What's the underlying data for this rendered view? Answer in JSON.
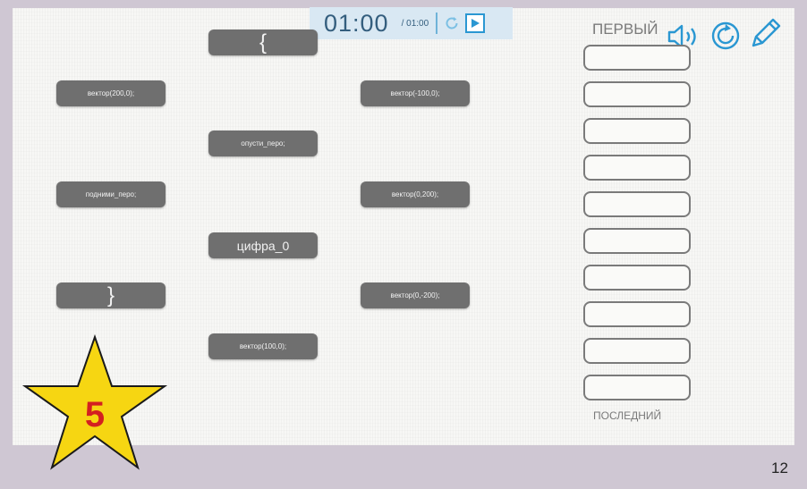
{
  "timer": {
    "time": "01:00",
    "total": "/ 01:00"
  },
  "cards": [
    {
      "id": "open-brace",
      "label": "{"
    },
    {
      "id": "vector-200-0",
      "label": "вектор(200,0);"
    },
    {
      "id": "vector-neg100-0",
      "label": "вектор(-100,0);"
    },
    {
      "id": "pen-down",
      "label": "опусти_перо;"
    },
    {
      "id": "pen-up",
      "label": "подними_перо;"
    },
    {
      "id": "vector-0-200",
      "label": "вектор(0,200);"
    },
    {
      "id": "digit-0",
      "label": "цифра_0"
    },
    {
      "id": "close-brace",
      "label": "}"
    },
    {
      "id": "vector-0-neg200",
      "label": "вектор(0,-200);"
    },
    {
      "id": "vector-100-0",
      "label": "вектор(100,0);"
    }
  ],
  "order_panel": {
    "first_label": "ПЕРВЫЙ",
    "last_label": "ПОСЛЕДНИЙ",
    "slot_count": 10
  },
  "star": {
    "score": "5",
    "fill_color": "#f6d612",
    "text_color": "#d42020"
  },
  "page_number": "12",
  "icons": [
    "speaker-icon",
    "refresh-icon",
    "pencil-icon",
    "reset-icon",
    "play-icon"
  ],
  "colors": {
    "card": "#6f6f6f",
    "accent": "#2a97d2",
    "timer_bg": "#d9e8f3"
  }
}
